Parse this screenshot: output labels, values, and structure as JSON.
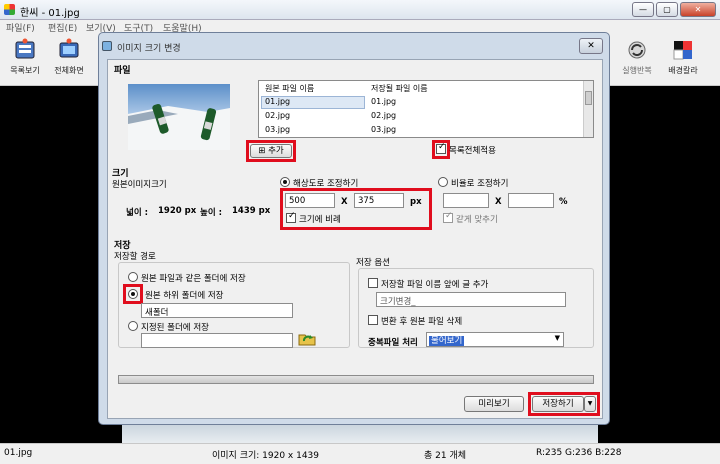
{
  "window": {
    "title": "한씨 - 01.jpg",
    "min": "—",
    "max": "▢",
    "close": "✕"
  },
  "menu": [
    "파일(F)",
    "편집(E)",
    "보기(V)",
    "도구(T)",
    "도움말(H)"
  ],
  "toolbar": {
    "left": [
      {
        "label": "목록보기",
        "icon": "list-view-icon"
      },
      {
        "label": "전체화면",
        "icon": "fullscreen-icon"
      }
    ],
    "right": [
      {
        "label": "실행반복",
        "icon": "repeat-icon"
      },
      {
        "label": "배경칼라",
        "icon": "background-color-icon"
      }
    ]
  },
  "status": {
    "file": "01.jpg",
    "size": "이미지 크기: 1920 x 1439",
    "count": "총 21 개체",
    "color": "R:235 G:236 B:228"
  },
  "dialog": {
    "title": "이미지 크기 변경",
    "close": "✕",
    "file_section": {
      "title": "파일",
      "col_original": "원본 파일 이름",
      "col_saved": "저장될 파일 이름",
      "rows": [
        {
          "original": "01.jpg",
          "saved": "01.jpg"
        },
        {
          "original": "02.jpg",
          "saved": "02.jpg"
        },
        {
          "original": "03.jpg",
          "saved": "03.jpg"
        }
      ],
      "add_button": "추가",
      "apply_all_label": "목록전체적용"
    },
    "size_section": {
      "title": "크기",
      "original_size_label": "원본이미지크기",
      "width_label": "넓이 :",
      "width_value": "1920 px",
      "height_label": "높이 :",
      "height_value": "1439 px",
      "resolution_option": "해상도로 조정하기",
      "res_width": "500",
      "res_x": "X",
      "res_height": "375",
      "res_unit": "px",
      "keep_ratio_label": "크기에 비례",
      "ratio_option": "비율로 조정하기",
      "ratio_x": "X",
      "ratio_unit": "%",
      "same_ratio_label": "같게 맞추기"
    },
    "save_section": {
      "title": "저장",
      "path_label": "저장할 경로",
      "opt_same_folder": "원본 파일과 같은 폴더에 저장",
      "opt_sub_folder": "원본 하위 폴더에 저장",
      "sub_folder_name": "새폴더",
      "opt_custom_folder": "지정된 폴더에 저장",
      "custom_folder_value": "",
      "options_label": "저장 옵션",
      "prefix_label": "저장할 파일 이름 앞에 글 추가",
      "prefix_value": "크기변경_",
      "delete_label": "변환 후 원본 파일 삭제",
      "dup_label": "중복파일 처리",
      "dup_value": "물어보기"
    },
    "preview_button": "미리보기",
    "save_button": "저장하기",
    "save_dropdown": "▼"
  }
}
